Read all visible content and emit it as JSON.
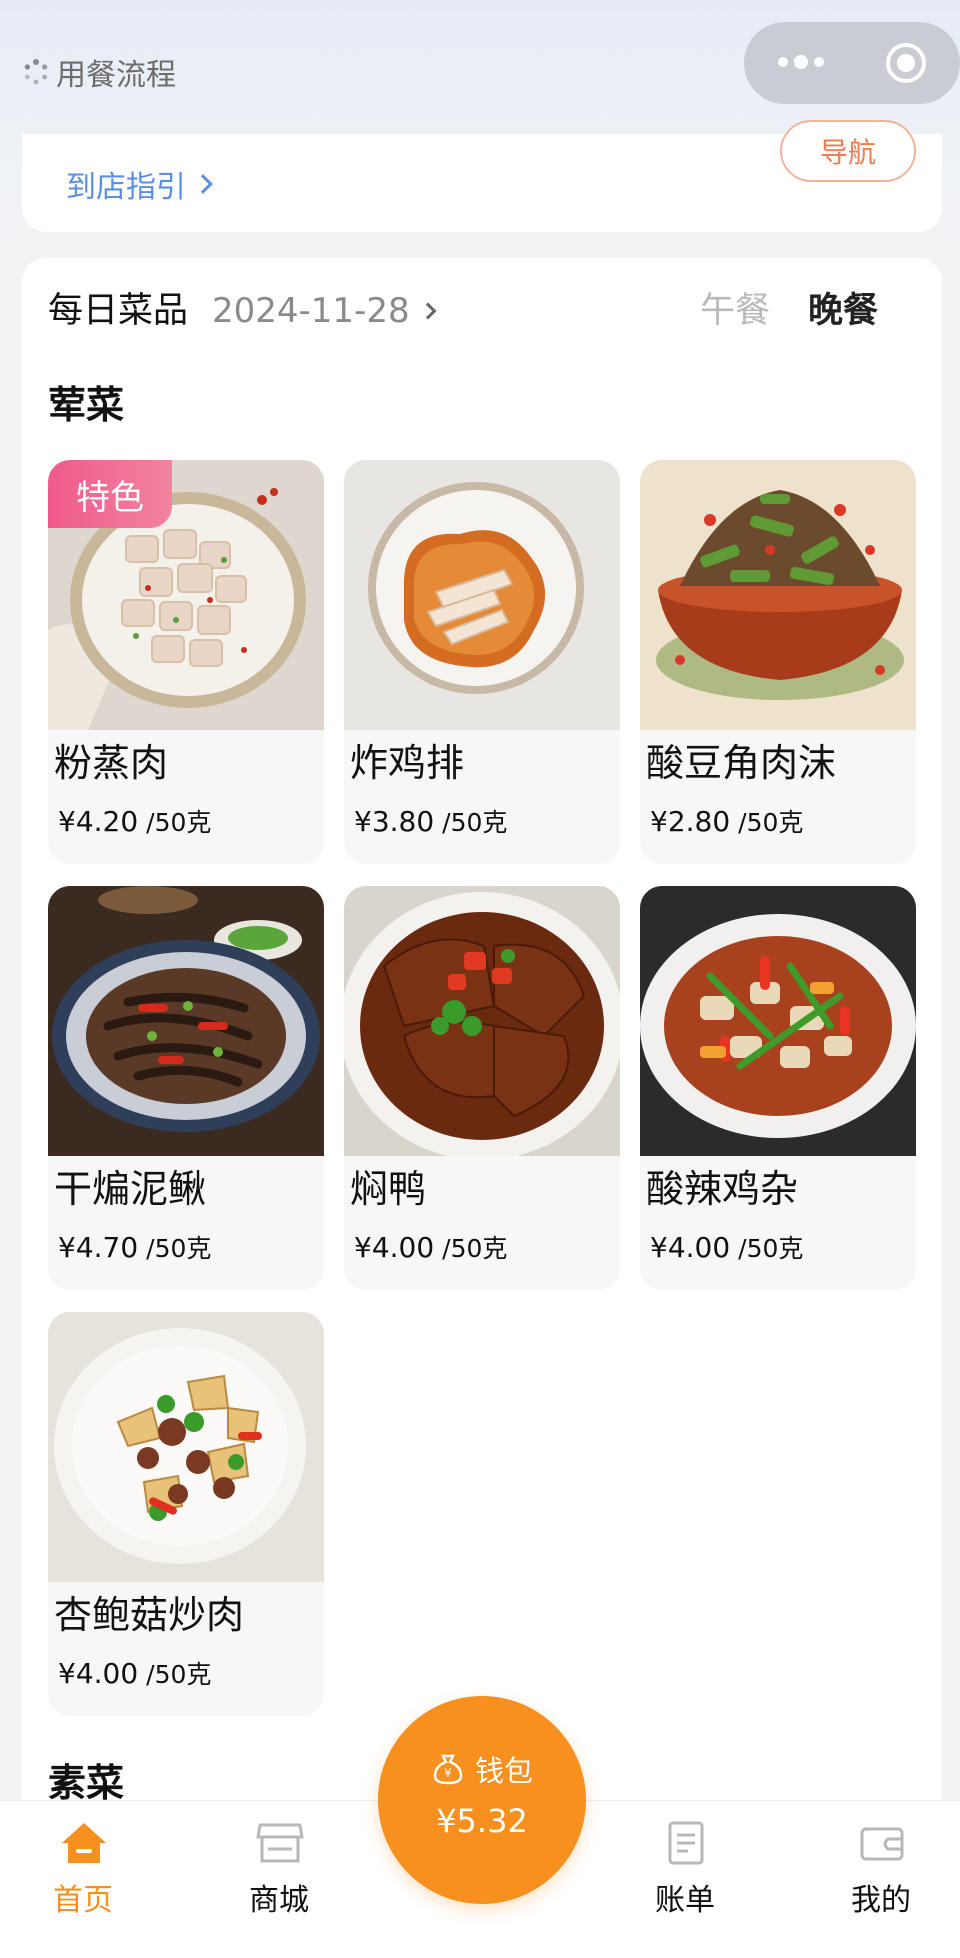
{
  "topbar": {
    "title": "用餐流程"
  },
  "store": {
    "nav_label": "导航",
    "guide_label": "到店指引"
  },
  "menu": {
    "title": "每日菜品",
    "date": "2024-11-28",
    "tabs": [
      {
        "label": "午餐",
        "active": false
      },
      {
        "label": "晚餐",
        "active": true
      }
    ]
  },
  "sections": [
    {
      "title": "荤菜",
      "dishes": [
        {
          "name": "粉蒸肉",
          "price": "¥4.20",
          "unit": "/50克",
          "tag": "特色"
        },
        {
          "name": "炸鸡排",
          "price": "¥3.80",
          "unit": "/50克"
        },
        {
          "name": "酸豆角肉沫",
          "price": "¥2.80",
          "unit": "/50克"
        },
        {
          "name": "干煸泥鳅",
          "price": "¥4.70",
          "unit": "/50克"
        },
        {
          "name": "焖鸭",
          "price": "¥4.00",
          "unit": "/50克"
        },
        {
          "name": "酸辣鸡杂",
          "price": "¥4.00",
          "unit": "/50克"
        },
        {
          "name": "杏鲍菇炒肉",
          "price": "¥4.00",
          "unit": "/50克"
        }
      ]
    },
    {
      "title": "素菜"
    }
  ],
  "wallet": {
    "label": "钱包",
    "amount": "¥5.32"
  },
  "tabbar": [
    {
      "label": "首页",
      "icon": "home-icon",
      "active": true
    },
    {
      "label": "商城",
      "icon": "store-icon",
      "active": false
    },
    {
      "label": "账单",
      "icon": "bill-icon",
      "active": false
    },
    {
      "label": "我的",
      "icon": "wallet-icon",
      "active": false
    }
  ],
  "colors": {
    "accent": "#f7901e",
    "link": "#5b8fe0",
    "tag": "#f05a8a",
    "nav_button": "#f07b4f"
  }
}
